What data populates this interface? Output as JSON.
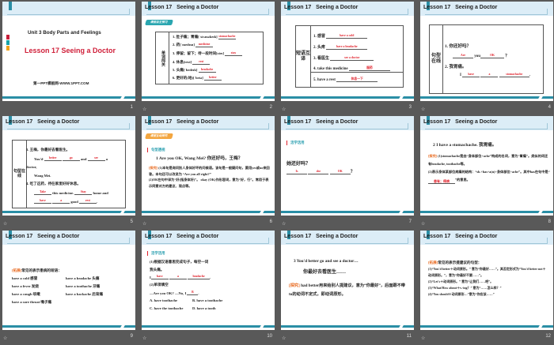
{
  "header_title": "Lesson 17   Seeing a Doctor",
  "footer_icon": "star-icon",
  "colors": {
    "accent": "#2a8ea5",
    "title_red": "#d0203a",
    "answer_red": "#e0202a",
    "header_bg": "#dcedf7"
  },
  "slides": [
    {
      "number": "1",
      "unit": "Unit 3  Body Parts and Feelings",
      "title": "Lesson 17 Seeing a Doctor",
      "site": "第一PPT模板网-WWW.1PPT.COM"
    },
    {
      "number": "2",
      "badge": "课前自主预习",
      "side": "单词闯关",
      "items": [
        {
          "q": "1.  肚子痛；胃痛[ˈstʌməkeɪk]",
          "a": "stomachache"
        },
        {
          "q": "2.  药[ˈmedɪsn]",
          "a": "medicine"
        },
        {
          "q": "3.  停留；留下；待一段时间[steɪ]",
          "a": "stay"
        },
        {
          "q": "4.  休息[rest]",
          "a": "rest"
        },
        {
          "q": "5.  头痛[ˈhedeɪk]",
          "a": "headache"
        },
        {
          "q": "6.  更好的(地)[ˈbetə]",
          "a": "better"
        }
      ]
    },
    {
      "number": "3",
      "side": "短语互译",
      "items": [
        {
          "q": "1.  感冒",
          "a": "have a cold"
        },
        {
          "q": "2.  头疼",
          "a": "have a headache"
        },
        {
          "q": "3.  看医生",
          "a": "see a doctor"
        },
        {
          "q": "4.  take this medicine",
          "a": "服药"
        },
        {
          "q": "5.  have a rest",
          "a": "休息一下"
        }
      ]
    },
    {
      "number": "4",
      "side": "句型在线",
      "q1": "1.  你还好吗？",
      "a1": "Are",
      "w1": "you",
      "a2": "OK",
      "p1": "？",
      "q2": "2.  我胃痛。",
      "w2": "I",
      "a3": "have",
      "a4": "a",
      "a5": "stomachache",
      "p2": "."
    },
    {
      "number": "5",
      "side": "句型在线",
      "q3": "3.  王梅，你最好去看医生。",
      "w1": "You'd",
      "a1": "better",
      "a2": "go",
      "w2": "and",
      "a3": "see",
      "w3": "a",
      "w4": "doctor,",
      "w5": "Wang Mei.",
      "q4": "4.  吃了这药，待在家里好好休息。",
      "a4": "Take",
      "w6": "this medicine.",
      "a5": "Stay",
      "w7": "home and",
      "a6": "have",
      "a7": "a",
      "w8": "good",
      "a8": "rest",
      "p": "."
    },
    {
      "number": "6",
      "badge": "课堂互动探究",
      "section": "句型透视",
      "sentence": "1    Are you OK, Wang Mei? 你还好吗，王梅？",
      "tag": "[探究]",
      "p1": "(1)本句是询问别人身体好坏的问候语。该句是一般疑问句，要用yes或no来回答。本句还可以改说为 “Are you all right?”",
      "p2": "(2)OK在句中译为“好(指身体好)”。 okay (OK)作形容词，意为“好，行”。常用于表示同意对方的建议、观点等。"
    },
    {
      "number": "7",
      "section": "活学活用",
      "q": "她还好吗？",
      "a1": "Is",
      "a2": "she",
      "a3": "OK",
      "p": "？"
    },
    {
      "number": "8",
      "sentence": "2    I have a stomachache. 我胃痛。",
      "tag": "[探究]",
      "p1": "(1)stomachache是由“身体部位+ache”构成的名词，意为“胃痛”。类似的词还有headache, toothache等。",
      "p2a": "(2)表示身体某部位疼痛的结构：“sb.+has+a(n)+身体部位+ache”。其中has在句中是“",
      "ans": "患有；得病",
      "p2b": "”的意思。"
    },
    {
      "number": "9",
      "tag": "[拓展]",
      "head": "常见的表示患病的短语：",
      "items": [
        "have a cold 感冒",
        "have a headache 头痛",
        "have a fever 发烧",
        "have a toothache 牙痛",
        "have a cough 咳嗽",
        "have a backache 后背痛",
        "have a sore throat 嗓子痛"
      ]
    },
    {
      "number": "10",
      "section": "活学活用",
      "l1": "(1)根据汉语意思完成句子，每空一词",
      "l2": "我头痛。",
      "w1": "I",
      "a1": "have",
      "a2": "a",
      "a3": "headache",
      "p": ".",
      "l3": "(2)单项填空",
      "l4a": "—Are you OK?    —No, I",
      "a4": "B",
      "l4b": ".",
      "opts": [
        "A. have toothache",
        "B. have a toothache",
        "C. have the toothache",
        "D. have a tooth"
      ]
    },
    {
      "number": "11",
      "sentence": "3    You'd  better go and  see a doctor…",
      "trans": "你最好去看医生……",
      "tag": "[探究]",
      "p": " had  better用来给别人提建议，意为“你最好”，后面跟不带to的动词不定式，即动词原形。"
    },
    {
      "number": "12",
      "tag": "[拓展]",
      "head": "常见的表示提建议的句型：",
      "lines": [
        "(1)“You'd better＋动词原形。” 意为“你最好……”。其否定形式为“You'd better not＋动词原形。”，意为“你最好不要……”。",
        "(2)“Let's＋动词原形。” 意为“让我们……吧”。",
        "(3)“What/How about＋v.-ing？” 意为“……怎么样？”",
        "(4)“You should＋动词原形…”意为“你应该……”"
      ]
    }
  ]
}
